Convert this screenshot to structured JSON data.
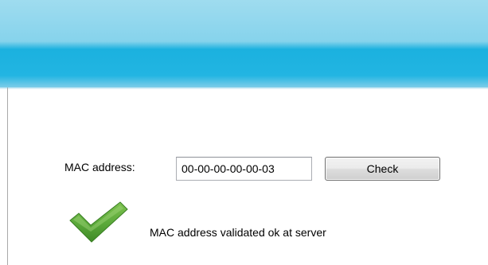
{
  "form": {
    "mac_label": "MAC address:",
    "mac_value": "00-00-00-00-00-03",
    "check_label": "Check"
  },
  "status": {
    "message": "MAC address validated ok at server",
    "icon": "check-icon",
    "icon_color": "#5aa83a"
  },
  "colors": {
    "header_light": "#9fdcef",
    "header_dark": "#1bb1df"
  }
}
